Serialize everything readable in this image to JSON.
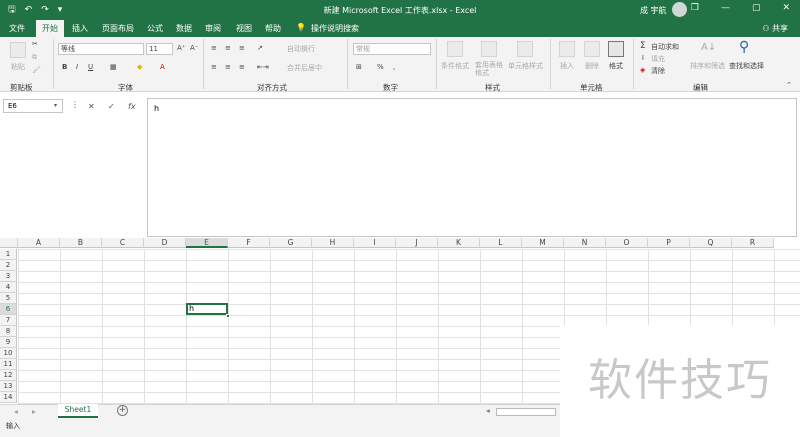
{
  "titlebar": {
    "title": "新建 Microsoft Excel 工作表.xlsx  -  Excel",
    "user": "成 宇航",
    "save": "🖫",
    "undo": "↶",
    "redo": "↷",
    "custom": "▾",
    "restore": "❐",
    "minimize": "—",
    "maximize": "▢",
    "close": "✕"
  },
  "tabs": {
    "file": "文件",
    "home": "开始",
    "insert": "插入",
    "layout": "页面布局",
    "formulas": "公式",
    "data": "数据",
    "review": "审阅",
    "view": "视图",
    "help": "帮助",
    "search": "操作说明搜索",
    "share": "共享"
  },
  "ribbon": {
    "clipboard": {
      "paste": "粘贴",
      "label": "剪贴板"
    },
    "font": {
      "name": "等线",
      "size": "11",
      "bold": "B",
      "italic": "I",
      "underline": "U",
      "grow": "A⁺",
      "shrink": "A⁻",
      "color": "A",
      "label": "字体"
    },
    "align": {
      "wrap": "自动换行",
      "merge": "合并后居中",
      "label": "对齐方式"
    },
    "number": {
      "format": "常规",
      "percent": "%",
      "comma": ",",
      "label": "数字"
    },
    "styles": {
      "cond": "条件格式",
      "table": "套用表格格式",
      "cell": "单元格样式",
      "label": "样式"
    },
    "cells": {
      "insert": "插入",
      "delete": "删除",
      "format": "格式",
      "label": "单元格"
    },
    "editing": {
      "autosum": "自动求和",
      "fill": "填充",
      "clear": "清除",
      "sort": "排序和筛选",
      "find": "查找和选择",
      "label": "编辑"
    }
  },
  "formula": {
    "namebox": "E6",
    "cancel": "✕",
    "enter": "✓",
    "fx": "fx",
    "value": "h"
  },
  "grid": {
    "columns": [
      "A",
      "B",
      "C",
      "D",
      "E",
      "F",
      "G",
      "H",
      "I",
      "J",
      "K",
      "L",
      "M",
      "N",
      "O",
      "P",
      "Q",
      "R"
    ],
    "rows": [
      "1",
      "2",
      "3",
      "4",
      "5",
      "6",
      "7",
      "8",
      "9",
      "10",
      "11",
      "12",
      "13",
      "14"
    ],
    "active_value": "h"
  },
  "sheets": {
    "tab": "Sheet1",
    "add": "+"
  },
  "status": {
    "mode": "输入"
  },
  "watermark": "软件技巧"
}
